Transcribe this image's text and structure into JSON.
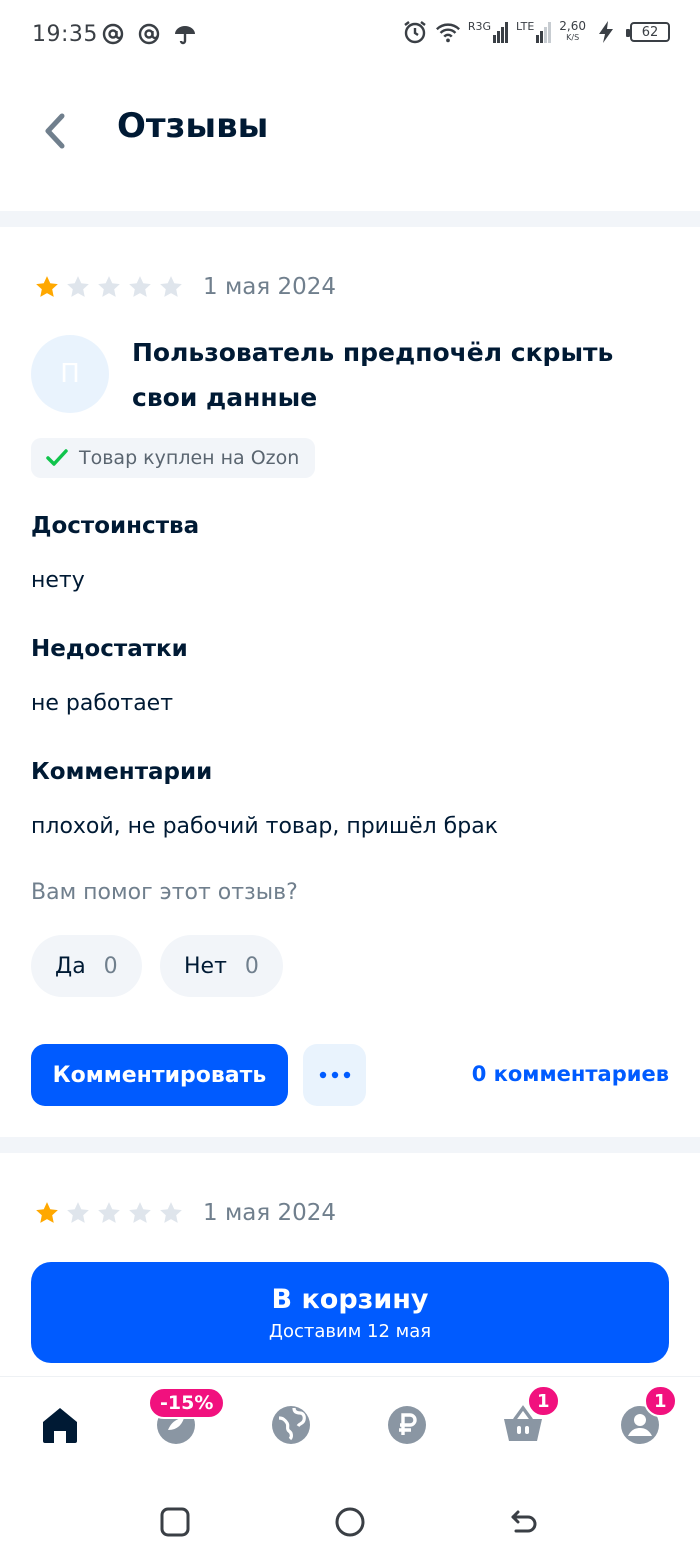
{
  "status_bar": {
    "time": "19:35",
    "network_1": "R3G",
    "network_2": "LTE",
    "speed_value": "2,60",
    "speed_unit": "K/S",
    "battery": "62"
  },
  "header": {
    "title": "Отзывы"
  },
  "reviews": [
    {
      "rating": 1,
      "max_rating": 5,
      "date": "1 мая 2024",
      "avatar_letter": "П",
      "author": "Пользователь предпочёл скрыть свои данные",
      "badge": "Товар куплен на Ozon",
      "pros_title": "Достоинства",
      "pros_text": "нету",
      "cons_title": "Недостатки",
      "cons_text": "не работает",
      "comment_title": "Комментарии",
      "comment_text": "плохой, не рабочий товар, пришёл брак",
      "helpful_question": "Вам помог этот отзыв?",
      "yes_label": "Да",
      "yes_count": "0",
      "no_label": "Нет",
      "no_count": "0",
      "comment_button": "Комментировать",
      "comments_count_label": "0 комментариев"
    },
    {
      "rating": 1,
      "max_rating": 5,
      "date": "1 мая 2024"
    }
  ],
  "cart_button": {
    "title": "В корзину",
    "subtitle": "Доставим 12 мая"
  },
  "bottom_nav": {
    "items": [
      {
        "icon": "home-icon",
        "badge": ""
      },
      {
        "icon": "fresh-icon",
        "badge": "-15%"
      },
      {
        "icon": "globe-icon",
        "badge": ""
      },
      {
        "icon": "ruble-icon",
        "badge": ""
      },
      {
        "icon": "cart-icon",
        "badge": "1"
      },
      {
        "icon": "profile-icon",
        "badge": "1"
      }
    ]
  },
  "colors": {
    "accent": "#005bff",
    "star_active": "#ffa800",
    "star_inactive": "#dfe5ec",
    "badge": "#f1117e",
    "check": "#10c44c"
  }
}
